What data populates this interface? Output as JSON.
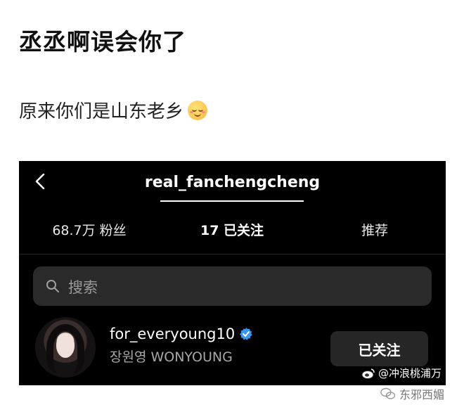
{
  "post": {
    "title": "丞丞啊误会你了",
    "body": "原来你们是山东老乡",
    "emoji": "relieved-face"
  },
  "screenshot": {
    "profile_name": "real_fanchengcheng",
    "tabs": [
      {
        "label": "68.7万 粉丝"
      },
      {
        "label": "17 已关注",
        "active": true
      },
      {
        "label": "推荐"
      }
    ],
    "search": {
      "placeholder": "搜索"
    },
    "account": {
      "username": "for_everyoung10",
      "verified": true,
      "full_name": "장원영 WONYOUNG",
      "button_label": "已关注"
    }
  },
  "watermarks": {
    "weibo": "@冲浪桃浦万",
    "wechat": "东邪西媚"
  },
  "colors": {
    "screen_bg": "#000000",
    "search_bg": "#2a2a2a",
    "verified_blue": "#3897f0"
  }
}
